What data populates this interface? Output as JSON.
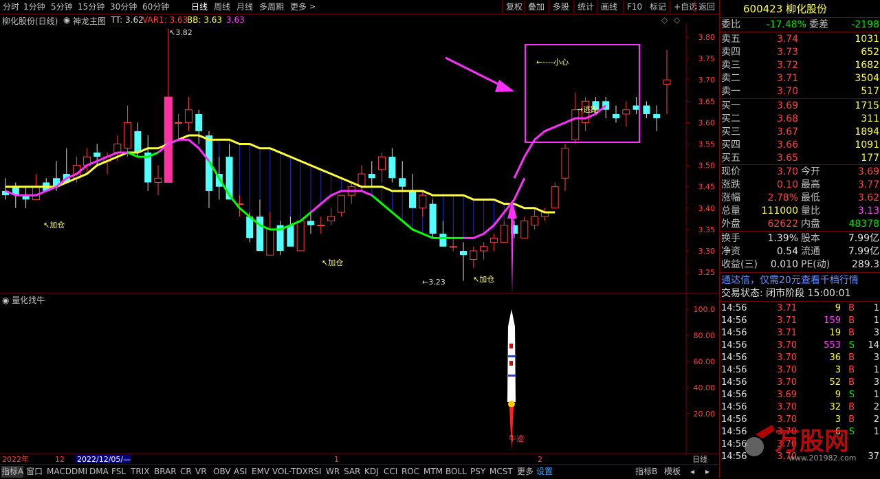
{
  "toolbar": {
    "periods": [
      "分时",
      "1分钟",
      "5分钟",
      "15分钟",
      "30分钟",
      "60分钟",
      "日线",
      "周线",
      "月线",
      "多周期",
      "更多"
    ],
    "active_period": "日线",
    "right_buttons": [
      "复权",
      "叠加",
      "多股",
      "统计",
      "画线",
      "F10",
      "标记",
      "+自选",
      "返回"
    ]
  },
  "chart_info": {
    "stock": "柳化股份(日线)",
    "indicator": "神龙主图",
    "tt": "TT: 3.62",
    "var1": "VAR1: 3.63",
    "bb": "BB: 3.63",
    "bb2": "3.63"
  },
  "annotations": {
    "high": "3.82",
    "low": "3.23",
    "jiacang1": "↖加仓",
    "jiacang2": "↖加仓",
    "jiacang3": "↖加仓",
    "xiaoxin": "←----小心",
    "taopao": "→逃跑",
    "niuji": "牛迹"
  },
  "price_axis": [
    "3.80",
    "3.75",
    "3.70",
    "3.65",
    "3.60",
    "3.55",
    "3.50",
    "3.45",
    "3.40",
    "3.35",
    "3.30",
    "3.25"
  ],
  "sub_panel": {
    "title": "量化找牛",
    "axis": [
      "100.0",
      "80.00",
      "60.00",
      "40.00",
      "20.00"
    ]
  },
  "time_axis": {
    "year": "2022年",
    "m12": "12",
    "date": "2022/12/05/—",
    "m1": "1",
    "m2": "2",
    "period": "日线"
  },
  "bottom_tabs": [
    "指标A",
    "窗口",
    "MACD",
    "DMI",
    "DMA",
    "FSL",
    "TRIX",
    "BRAR",
    "CR",
    "VR",
    "OBV",
    "ASI",
    "EMV",
    "VOL-TDX",
    "RSI",
    "WR",
    "SAR",
    "KDJ",
    "CCI",
    "ROC",
    "MTM",
    "BOLL",
    "PSY",
    "MCST",
    "更多",
    "设置"
  ],
  "bottom_right": [
    "指标B",
    "模板"
  ],
  "quote": {
    "code": "600423",
    "name": "柳化股份",
    "weibi_label": "委比",
    "weibi": "-17.48%",
    "weicha_label": "委差",
    "weicha": "-2198",
    "asks": [
      {
        "label": "卖五",
        "price": "3.74",
        "vol": "1031"
      },
      {
        "label": "卖四",
        "price": "3.73",
        "vol": "652"
      },
      {
        "label": "卖三",
        "price": "3.72",
        "vol": "1682"
      },
      {
        "label": "卖二",
        "price": "3.71",
        "vol": "3504"
      },
      {
        "label": "卖一",
        "price": "3.70",
        "vol": "517"
      }
    ],
    "bids": [
      {
        "label": "买一",
        "price": "3.69",
        "vol": "1715"
      },
      {
        "label": "买二",
        "price": "3.68",
        "vol": "311"
      },
      {
        "label": "买三",
        "price": "3.67",
        "vol": "1894"
      },
      {
        "label": "买四",
        "price": "3.66",
        "vol": "1091"
      },
      {
        "label": "买五",
        "price": "3.65",
        "vol": "177"
      }
    ],
    "stats": [
      {
        "l1": "现价",
        "v1": "3.70",
        "l2": "今开",
        "v2": "3.69",
        "c1": "red",
        "c2": "red"
      },
      {
        "l1": "涨跌",
        "v1": "0.10",
        "l2": "最高",
        "v2": "3.77",
        "c1": "red",
        "c2": "red"
      },
      {
        "l1": "涨幅",
        "v1": "2.78%",
        "l2": "最低",
        "v2": "3.62",
        "c1": "red",
        "c2": "red"
      },
      {
        "l1": "总量",
        "v1": "111000",
        "l2": "量比",
        "v2": "3.13",
        "c1": "yel",
        "c2": "mag"
      },
      {
        "l1": "外盘",
        "v1": "62622",
        "l2": "内盘",
        "v2": "48378",
        "c1": "red",
        "c2": "grn"
      }
    ],
    "stats2": [
      {
        "l1": "换手",
        "v1": "1.39%",
        "l2": "股本",
        "v2": "7.99亿"
      },
      {
        "l1": "净资",
        "v1": "0.54",
        "l2": "流通",
        "v2": "7.99亿"
      },
      {
        "l1": "收益(三)",
        "v1": "0.010",
        "l2": "PE(动)",
        "v2": "289.3"
      }
    ],
    "notice": "通达信，仅需20元查看千档行情",
    "trade_status": "交易状态: 闭市阶段 15:00:01"
  },
  "ticks": [
    {
      "t": "14:56",
      "p": "3.71",
      "v": "9",
      "s": "B",
      "n": "1"
    },
    {
      "t": "14:56",
      "p": "3.71",
      "v": "159",
      "s": "B",
      "n": "1"
    },
    {
      "t": "14:56",
      "p": "3.71",
      "v": "19",
      "s": "B",
      "n": "3"
    },
    {
      "t": "14:56",
      "p": "3.70",
      "v": "553",
      "s": "S",
      "n": "14"
    },
    {
      "t": "14:56",
      "p": "3.70",
      "v": "36",
      "s": "B",
      "n": "3"
    },
    {
      "t": "14:56",
      "p": "3.70",
      "v": "3",
      "s": "B",
      "n": "1"
    },
    {
      "t": "14:56",
      "p": "3.70",
      "v": "52",
      "s": "B",
      "n": "3"
    },
    {
      "t": "14:56",
      "p": "3.69",
      "v": "9",
      "s": "S",
      "n": "1"
    },
    {
      "t": "14:56",
      "p": "3.70",
      "v": "32",
      "s": "B",
      "n": "2"
    },
    {
      "t": "14:56",
      "p": "3.70",
      "v": "3",
      "s": "B",
      "n": "2"
    },
    {
      "t": "14:56",
      "p": "3.70",
      "v": "6",
      "s": "S",
      "n": "1"
    },
    {
      "t": "14:56",
      "p": "3.70",
      "v": "",
      "s": "",
      "n": ""
    },
    {
      "t": "14:56",
      "p": "3.70",
      "v": "",
      "s": "",
      "n": "37"
    }
  ],
  "watermark": {
    "brand": "万股网",
    "url": "www.201982.com"
  },
  "colors": {
    "up": "#ff4040",
    "down": "#54ffff",
    "yellow_line": "#ffff40",
    "green_line": "#00ff00",
    "magenta_line": "#ff30ff",
    "grid": "#700000"
  }
}
